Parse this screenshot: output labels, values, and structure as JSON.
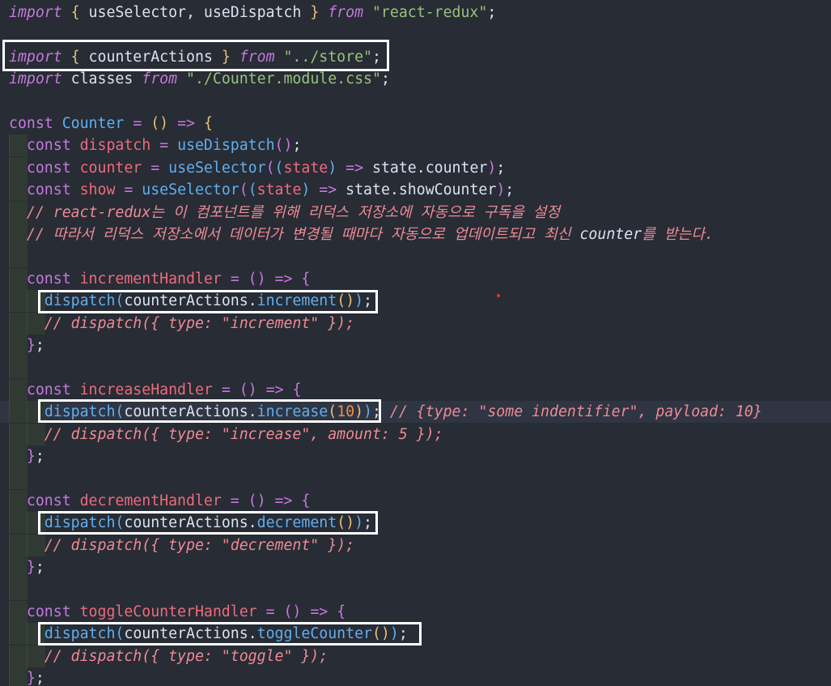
{
  "editor": {
    "lines": [
      [
        [
          "kw-i",
          "import"
        ],
        [
          "txt",
          " "
        ],
        [
          "pa",
          "{"
        ],
        [
          "txt",
          " useSelector, useDispatch "
        ],
        [
          "pa",
          "}"
        ],
        [
          "txt",
          " "
        ],
        [
          "kw-i",
          "from"
        ],
        [
          "txt",
          " "
        ],
        [
          "str",
          "\"react-redux\""
        ],
        [
          "txt",
          ";"
        ]
      ],
      [],
      [
        [
          "kw-i",
          "import"
        ],
        [
          "txt",
          " "
        ],
        [
          "pa",
          "{"
        ],
        [
          "txt",
          " counterActions "
        ],
        [
          "pa",
          "}"
        ],
        [
          "txt",
          " "
        ],
        [
          "kw-i",
          "from"
        ],
        [
          "txt",
          " "
        ],
        [
          "str",
          "\"../store\""
        ],
        [
          "txt",
          ";"
        ]
      ],
      [
        [
          "kw-i",
          "import"
        ],
        [
          "txt",
          " classes "
        ],
        [
          "kw-i",
          "from"
        ],
        [
          "txt",
          " "
        ],
        [
          "str",
          "\"./Counter.module.css\""
        ],
        [
          "txt",
          ";"
        ]
      ],
      [],
      [
        [
          "kw",
          "const"
        ],
        [
          "txt",
          " "
        ],
        [
          "def",
          "Counter"
        ],
        [
          "txt",
          " "
        ],
        [
          "op",
          "="
        ],
        [
          "txt",
          " "
        ],
        [
          "pa",
          "()"
        ],
        [
          "txt",
          " "
        ],
        [
          "op",
          "=>"
        ],
        [
          "txt",
          " "
        ],
        [
          "pa",
          "{"
        ]
      ],
      [
        [
          "txt",
          "  "
        ],
        [
          "kw",
          "const"
        ],
        [
          "txt",
          " "
        ],
        [
          "var",
          "dispatch"
        ],
        [
          "txt",
          " "
        ],
        [
          "op",
          "="
        ],
        [
          "txt",
          " "
        ],
        [
          "fn",
          "useDispatch"
        ],
        [
          "pb",
          "()"
        ],
        [
          "txt",
          ";"
        ]
      ],
      [
        [
          "txt",
          "  "
        ],
        [
          "kw",
          "const"
        ],
        [
          "txt",
          " "
        ],
        [
          "var",
          "counter"
        ],
        [
          "txt",
          " "
        ],
        [
          "op",
          "="
        ],
        [
          "txt",
          " "
        ],
        [
          "fn",
          "useSelector"
        ],
        [
          "pb",
          "("
        ],
        [
          "pc",
          "("
        ],
        [
          "var",
          "state"
        ],
        [
          "pc",
          ")"
        ],
        [
          "txt",
          " "
        ],
        [
          "op",
          "=>"
        ],
        [
          "txt",
          " state.counter"
        ],
        [
          "pb",
          ")"
        ],
        [
          "txt",
          ";"
        ]
      ],
      [
        [
          "txt",
          "  "
        ],
        [
          "kw",
          "const"
        ],
        [
          "txt",
          " "
        ],
        [
          "var",
          "show"
        ],
        [
          "txt",
          " "
        ],
        [
          "op",
          "="
        ],
        [
          "txt",
          " "
        ],
        [
          "fn",
          "useSelector"
        ],
        [
          "pb",
          "("
        ],
        [
          "pc",
          "("
        ],
        [
          "var",
          "state"
        ],
        [
          "pc",
          ")"
        ],
        [
          "txt",
          " "
        ],
        [
          "op",
          "=>"
        ],
        [
          "txt",
          " state.showCounter"
        ],
        [
          "pb",
          ")"
        ],
        [
          "txt",
          ";"
        ]
      ],
      [
        [
          "txt",
          "  "
        ],
        [
          "cmt",
          "// react-redux는 이 컴포넌트를 위해 리덕스 저장소에 자동으로 구독을 설정"
        ]
      ],
      [
        [
          "txt",
          "  "
        ],
        [
          "cmt",
          "// 따라서 리덕스 저장소에서 데이터가 변경될 때마다 자동으로 업데이트되고 최신 "
        ],
        [
          "cmt-w",
          "counter"
        ],
        [
          "cmt",
          "를 받는다."
        ]
      ],
      [],
      [
        [
          "txt",
          "  "
        ],
        [
          "kw",
          "const"
        ],
        [
          "txt",
          " "
        ],
        [
          "var",
          "incrementHandler"
        ],
        [
          "txt",
          " "
        ],
        [
          "op",
          "="
        ],
        [
          "txt",
          " "
        ],
        [
          "pb",
          "()"
        ],
        [
          "txt",
          " "
        ],
        [
          "op",
          "=>"
        ],
        [
          "txt",
          " "
        ],
        [
          "pb",
          "{"
        ]
      ],
      [
        [
          "txt",
          "    "
        ],
        [
          "fn",
          "dispatch"
        ],
        [
          "pc",
          "("
        ],
        [
          "txt",
          "counterActions."
        ],
        [
          "prop",
          "increment"
        ],
        [
          "pa",
          "()"
        ],
        [
          "pc",
          ")"
        ],
        [
          "txt",
          ";"
        ]
      ],
      [
        [
          "txt",
          "    "
        ],
        [
          "cmt",
          "// dispatch({ type: \"increment\" });"
        ]
      ],
      [
        [
          "txt",
          "  "
        ],
        [
          "pb",
          "}"
        ],
        [
          "txt",
          ";"
        ]
      ],
      [],
      [
        [
          "txt",
          "  "
        ],
        [
          "kw",
          "const"
        ],
        [
          "txt",
          " "
        ],
        [
          "var",
          "increaseHandler"
        ],
        [
          "txt",
          " "
        ],
        [
          "op",
          "="
        ],
        [
          "txt",
          " "
        ],
        [
          "pb",
          "()"
        ],
        [
          "txt",
          " "
        ],
        [
          "op",
          "=>"
        ],
        [
          "txt",
          " "
        ],
        [
          "pb",
          "{"
        ]
      ],
      [
        [
          "txt",
          "    "
        ],
        [
          "fn",
          "dispatch"
        ],
        [
          "pc",
          "("
        ],
        [
          "txt",
          "counterActions."
        ],
        [
          "prop",
          "increase"
        ],
        [
          "pa",
          "("
        ],
        [
          "num",
          "10"
        ],
        [
          "pa",
          ")"
        ],
        [
          "pc",
          ")"
        ],
        [
          "txt",
          "; "
        ],
        [
          "cmt",
          "// {type: \"some indentifier\", payload: 10}"
        ]
      ],
      [
        [
          "txt",
          "    "
        ],
        [
          "cmt",
          "// dispatch({ type: \"increase\", amount: 5 });"
        ]
      ],
      [
        [
          "txt",
          "  "
        ],
        [
          "pb",
          "}"
        ],
        [
          "txt",
          ";"
        ]
      ],
      [],
      [
        [
          "txt",
          "  "
        ],
        [
          "kw",
          "const"
        ],
        [
          "txt",
          " "
        ],
        [
          "var",
          "decrementHandler"
        ],
        [
          "txt",
          " "
        ],
        [
          "op",
          "="
        ],
        [
          "txt",
          " "
        ],
        [
          "pb",
          "()"
        ],
        [
          "txt",
          " "
        ],
        [
          "op",
          "=>"
        ],
        [
          "txt",
          " "
        ],
        [
          "pb",
          "{"
        ]
      ],
      [
        [
          "txt",
          "    "
        ],
        [
          "fn",
          "dispatch"
        ],
        [
          "pc",
          "("
        ],
        [
          "txt",
          "counterActions."
        ],
        [
          "prop",
          "decrement"
        ],
        [
          "pa",
          "()"
        ],
        [
          "pc",
          ")"
        ],
        [
          "txt",
          ";"
        ]
      ],
      [
        [
          "txt",
          "    "
        ],
        [
          "cmt",
          "// dispatch({ type: \"decrement\" });"
        ]
      ],
      [
        [
          "txt",
          "  "
        ],
        [
          "pb",
          "}"
        ],
        [
          "txt",
          ";"
        ]
      ],
      [],
      [
        [
          "txt",
          "  "
        ],
        [
          "kw",
          "const"
        ],
        [
          "txt",
          " "
        ],
        [
          "var",
          "toggleCounterHandler"
        ],
        [
          "txt",
          " "
        ],
        [
          "op",
          "="
        ],
        [
          "txt",
          " "
        ],
        [
          "pb",
          "()"
        ],
        [
          "txt",
          " "
        ],
        [
          "op",
          "=>"
        ],
        [
          "txt",
          " "
        ],
        [
          "pb",
          "{"
        ]
      ],
      [
        [
          "txt",
          "    "
        ],
        [
          "fn",
          "dispatch"
        ],
        [
          "pc",
          "("
        ],
        [
          "txt",
          "counterActions."
        ],
        [
          "prop",
          "toggleCounter"
        ],
        [
          "pa",
          "()"
        ],
        [
          "pc",
          ")"
        ],
        [
          "txt",
          ";"
        ]
      ],
      [
        [
          "txt",
          "    "
        ],
        [
          "cmt",
          "// dispatch({ type: \"toggle\" });"
        ]
      ],
      [
        [
          "txt",
          "  "
        ],
        [
          "pb",
          "}"
        ],
        [
          "txt",
          ";"
        ]
      ]
    ],
    "active_line_index": 18,
    "colors": {
      "background": "#272c35",
      "highlight_box": "#ffffff",
      "keyword": "#c678dd",
      "function": "#61afef",
      "variable": "#ef6b7b",
      "string": "#98c379",
      "number": "#f08d49",
      "comment": "#ef8a94"
    }
  }
}
